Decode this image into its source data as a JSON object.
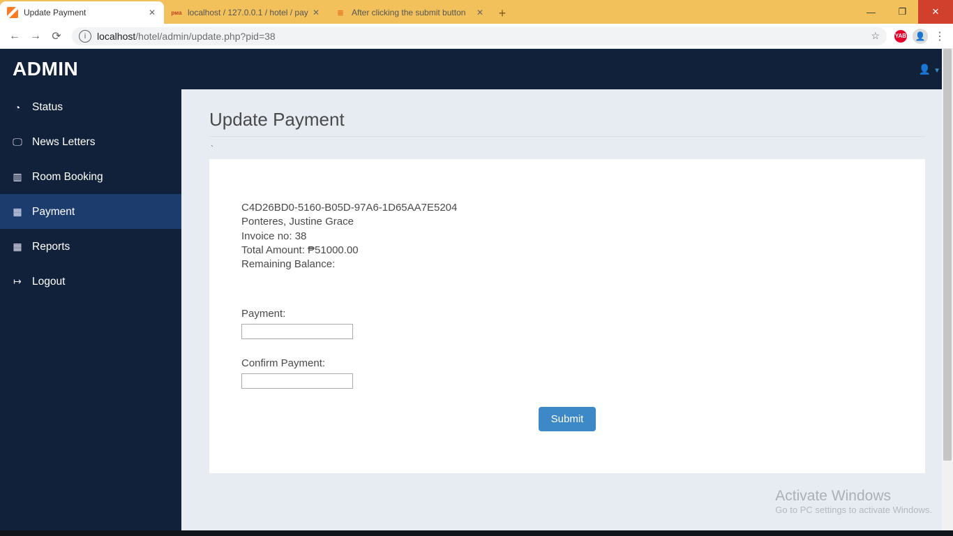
{
  "browser": {
    "tabs": [
      {
        "title": "Update Payment",
        "active": true
      },
      {
        "title": "localhost / 127.0.0.1 / hotel / pay",
        "active": false
      },
      {
        "title": "After clicking the submit button",
        "active": false
      }
    ],
    "url_host": "localhost",
    "url_path": "/hotel/admin/update.php?pid=38"
  },
  "header": {
    "brand": "ADMIN"
  },
  "sidebar": {
    "items": [
      {
        "label": "Status",
        "glyph": "◉",
        "active": false
      },
      {
        "label": "News Letters",
        "glyph": "🖵",
        "active": false
      },
      {
        "label": "Room Booking",
        "glyph": "▥",
        "active": false
      },
      {
        "label": "Payment",
        "glyph": "▦",
        "active": true
      },
      {
        "label": "Reports",
        "glyph": "▥",
        "active": false
      },
      {
        "label": "Logout",
        "glyph": "↪",
        "active": false
      }
    ]
  },
  "page": {
    "title": "Update Payment",
    "card": {
      "guid": "C4D26BD0-5160-B05D-97A6-1D65AA7E5204",
      "name": "Ponteres, Justine Grace",
      "invoice_line": "Invoice no: 38",
      "total_line": "Total Amount: ₱51000.00",
      "balance_line": "Remaining Balance:",
      "payment_label": "Payment:",
      "confirm_label": "Confirm Payment:",
      "submit_label": "Submit"
    }
  },
  "watermark": {
    "line1": "Activate Windows",
    "line2": "Go to PC settings to activate Windows."
  }
}
